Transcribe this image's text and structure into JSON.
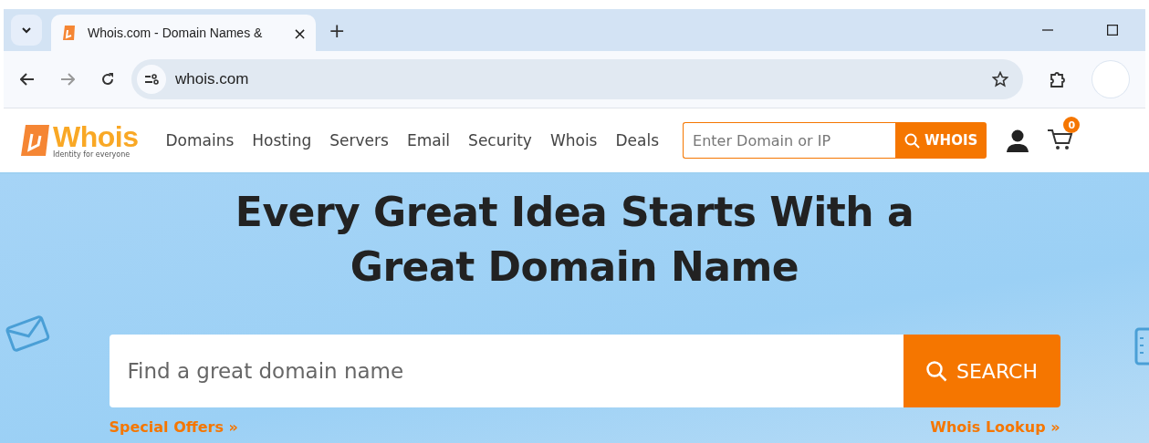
{
  "browser": {
    "tab": {
      "title": "Whois.com - Domain Names &",
      "close": "×"
    },
    "new_tab": "+",
    "address": "whois.com"
  },
  "site": {
    "logo": {
      "name": "Whois",
      "tagline": "Identity for everyone"
    },
    "nav": [
      "Domains",
      "Hosting",
      "Servers",
      "Email",
      "Security",
      "Whois",
      "Deals"
    ],
    "search": {
      "placeholder": "Enter Domain or IP",
      "button": "WHOIS"
    },
    "cart_count": "0"
  },
  "hero": {
    "headline": [
      "Every Great Idea Starts With a",
      "Great Domain Name"
    ],
    "search": {
      "placeholder": "Find a great domain name",
      "button": "SEARCH"
    },
    "links": [
      "Special Offers »",
      "Whois Lookup »"
    ]
  }
}
